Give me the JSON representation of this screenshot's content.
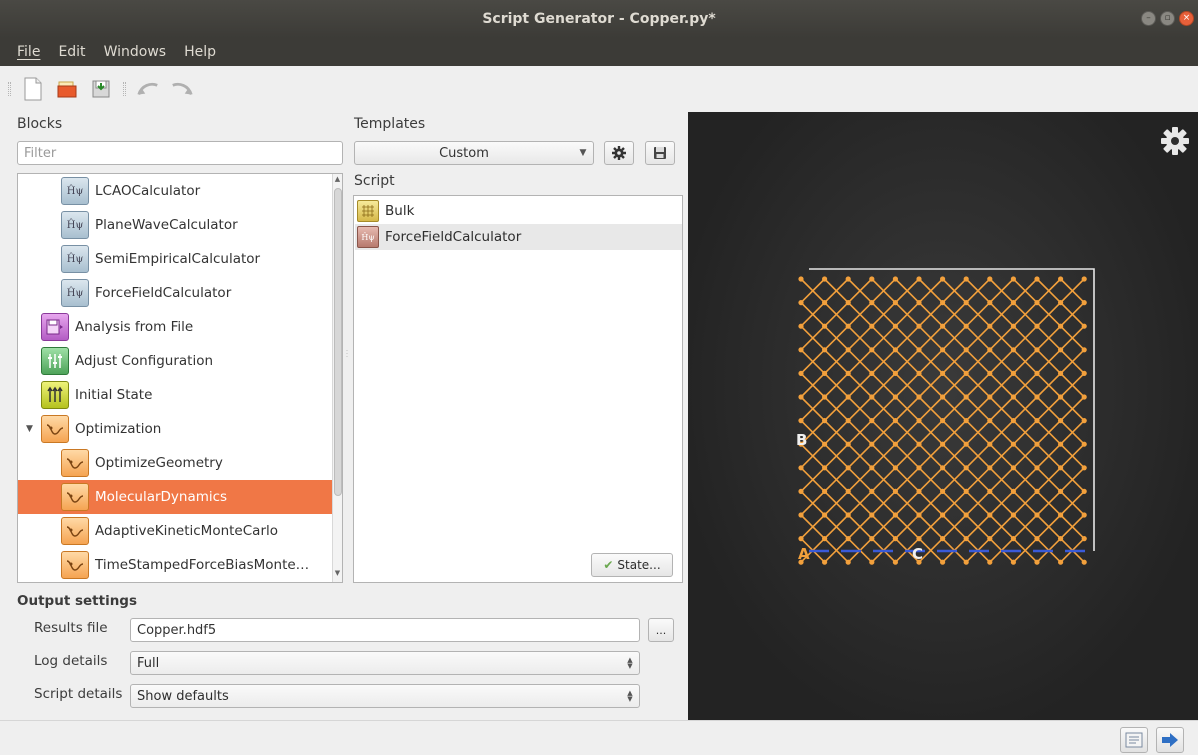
{
  "window": {
    "title": "Script Generator - Copper.py*"
  },
  "menu": [
    "File",
    "Edit",
    "Windows",
    "Help"
  ],
  "toolbar": {
    "new": "new-file-icon",
    "open": "open-folder-icon",
    "save": "save-icon",
    "undo": "undo-icon",
    "redo": "redo-icon"
  },
  "blocks": {
    "label": "Blocks",
    "filter_placeholder": "Filter",
    "items": [
      {
        "label": "LCAOCalculator",
        "icon": "h-psi-icon"
      },
      {
        "label": "PlaneWaveCalculator",
        "icon": "h-psi-icon"
      },
      {
        "label": "SemiEmpiricalCalculator",
        "icon": "h-psi-icon"
      },
      {
        "label": "ForceFieldCalculator",
        "icon": "h-psi-icon"
      },
      {
        "label": "Analysis from File",
        "icon": "analysis-file-icon"
      },
      {
        "label": "Adjust Configuration",
        "icon": "adjust-configuration-icon"
      },
      {
        "label": "Initial State",
        "icon": "initial-state-icon"
      },
      {
        "label": "Optimization",
        "icon": "optimization-icon"
      },
      {
        "label": "OptimizeGeometry",
        "icon": "optimization-icon"
      },
      {
        "label": "MolecularDynamics",
        "icon": "optimization-icon"
      },
      {
        "label": "AdaptiveKineticMonteCarlo",
        "icon": "optimization-icon"
      },
      {
        "label": "TimeStampedForceBiasMonte…",
        "icon": "optimization-icon"
      }
    ]
  },
  "templates": {
    "label": "Templates",
    "selected": "Custom"
  },
  "script": {
    "label": "Script",
    "items": [
      {
        "label": "Bulk"
      },
      {
        "label": "ForceFieldCalculator"
      }
    ],
    "state_button": "State..."
  },
  "viewer": {
    "axis_b": "B",
    "axis_c": "C",
    "axis_a": "A",
    "colors": {
      "atom": "#f2a03c",
      "cell": "#e6e6e6",
      "axis": "#3a5ad8"
    }
  },
  "output": {
    "title": "Output settings",
    "results_file_label": "Results file",
    "results_file_value": "Copper.hdf5",
    "browse_label": "...",
    "log_details_label": "Log details",
    "log_details_value": "Full",
    "script_details_label": "Script details",
    "script_details_value": "Show defaults"
  }
}
